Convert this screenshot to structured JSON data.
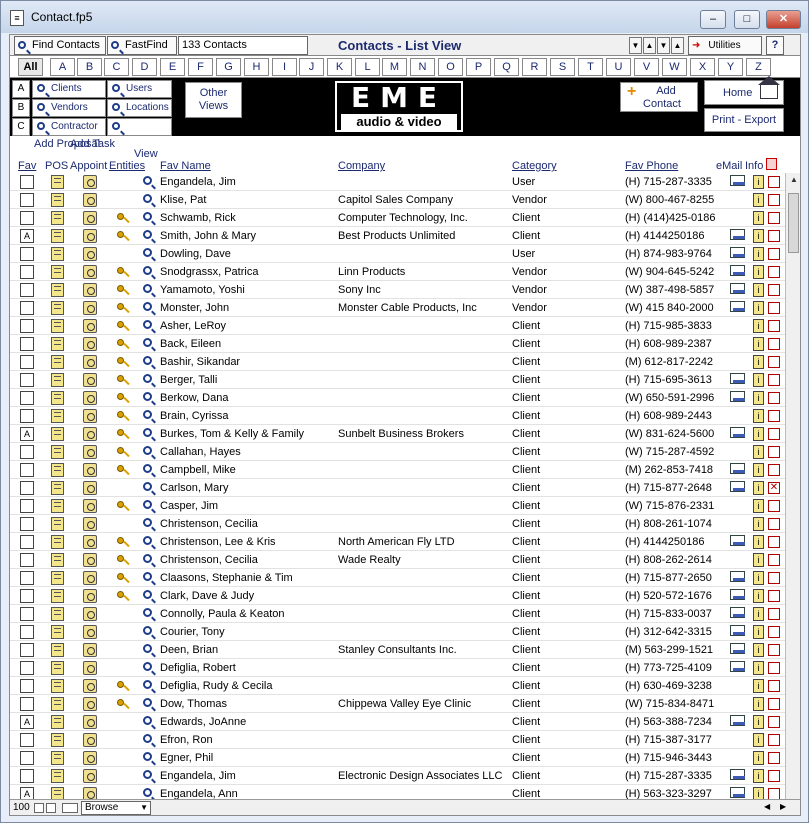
{
  "window": {
    "title": "Contact.fp5"
  },
  "toolbar": {
    "find_label": "Find Contacts",
    "fastfind_label": "FastFind",
    "count_label": "133 Contacts",
    "heading": "Contacts - List View",
    "utilities_label": "Utilities",
    "help_label": "?"
  },
  "alphabet": [
    "All",
    "A",
    "B",
    "C",
    "D",
    "E",
    "F",
    "G",
    "H",
    "I",
    "J",
    "K",
    "L",
    "M",
    "N",
    "O",
    "P",
    "Q",
    "R",
    "S",
    "T",
    "U",
    "V",
    "W",
    "X",
    "Y",
    "Z"
  ],
  "nav": {
    "rows": [
      {
        "letter": "A",
        "left": "Clients",
        "right": "Users"
      },
      {
        "letter": "B",
        "left": "Vendors",
        "right": "Locations"
      },
      {
        "letter": "C",
        "left": "Contractor",
        "right": ""
      }
    ],
    "other_views_line1": "Other",
    "other_views_line2": "Views",
    "logo_top": "EME",
    "logo_bottom": "audio & video",
    "add_contact_line1": "Add",
    "add_contact_line2": "Contact",
    "home_label": "Home",
    "print_export_label": "Print - Export"
  },
  "columns": {
    "add_proposal": "Add Proposal",
    "add_task": "Add Task",
    "view": "View",
    "fav": "Fav",
    "pos": "POS",
    "appoint": "Appoint",
    "entities": "Entities",
    "fav_name": "Fav Name",
    "company": "Company",
    "category": "Category",
    "fav_phone": "Fav Phone",
    "email": "eMail",
    "info": "Info"
  },
  "rows": [
    {
      "fav": "",
      "key": false,
      "name": "Engandela, Jim",
      "company": "",
      "category": "User",
      "phone": "(H) 715-287-3335",
      "email": true,
      "del": false
    },
    {
      "fav": "",
      "key": false,
      "name": "Klise, Pat",
      "company": "Capitol Sales Company",
      "category": "Vendor",
      "phone": "(W) 800-467-8255",
      "email": false,
      "del": false
    },
    {
      "fav": "",
      "key": true,
      "name": "Schwamb, Rick",
      "company": "Computer Technology, Inc.",
      "category": "Client",
      "phone": "(H) (414)425-0186",
      "email": false,
      "del": false
    },
    {
      "fav": "A",
      "key": true,
      "name": "Smith, John & Mary",
      "company": "Best Products Unlimited",
      "category": "Client",
      "phone": "(H) 4144250186",
      "email": true,
      "del": false
    },
    {
      "fav": "",
      "key": false,
      "name": "Dowling, Dave",
      "company": "",
      "category": "User",
      "phone": "(H) 874-983-9764",
      "email": true,
      "del": false
    },
    {
      "fav": "",
      "key": true,
      "name": "Snodgrassx, Patrica",
      "company": "Linn Products",
      "category": "Vendor",
      "phone": "(W) 904-645-5242",
      "email": true,
      "del": false
    },
    {
      "fav": "",
      "key": true,
      "name": "Yamamoto, Yoshi",
      "company": "Sony Inc",
      "category": "Vendor",
      "phone": "(W) 387-498-5857",
      "email": true,
      "del": false
    },
    {
      "fav": "",
      "key": true,
      "name": "Monster, John",
      "company": "Monster Cable Products, Inc",
      "category": "Vendor",
      "phone": "(W) 415 840-2000",
      "email": true,
      "del": false
    },
    {
      "fav": "",
      "key": true,
      "name": "Asher, LeRoy",
      "company": "",
      "category": "Client",
      "phone": "(H) 715-985-3833",
      "email": false,
      "del": false
    },
    {
      "fav": "",
      "key": true,
      "name": "Back, Eileen",
      "company": "",
      "category": "Client",
      "phone": "(H) 608-989-2387",
      "email": false,
      "del": false
    },
    {
      "fav": "",
      "key": true,
      "name": "Bashir, Sikandar",
      "company": "",
      "category": "Client",
      "phone": "(M) 612-817-2242",
      "email": false,
      "del": false
    },
    {
      "fav": "",
      "key": true,
      "name": "Berger, Talli",
      "company": "",
      "category": "Client",
      "phone": "(H) 715-695-3613",
      "email": true,
      "del": false
    },
    {
      "fav": "",
      "key": true,
      "name": "Berkow, Dana",
      "company": "",
      "category": "Client",
      "phone": "(W) 650-591-2996",
      "email": true,
      "del": false
    },
    {
      "fav": "",
      "key": true,
      "name": "Brain, Cyrissa",
      "company": "",
      "category": "Client",
      "phone": "(H) 608-989-2443",
      "email": false,
      "del": false
    },
    {
      "fav": "A",
      "key": true,
      "name": "Burkes, Tom & Kelly & Family",
      "company": "Sunbelt Business Brokers",
      "category": "Client",
      "phone": "(W) 831-624-5600",
      "email": true,
      "del": false
    },
    {
      "fav": "",
      "key": true,
      "name": "Callahan, Hayes",
      "company": "",
      "category": "Client",
      "phone": "(W) 715-287-4592",
      "email": false,
      "del": false
    },
    {
      "fav": "",
      "key": true,
      "name": "Campbell, Mike",
      "company": "",
      "category": "Client",
      "phone": "(M) 262-853-7418",
      "email": true,
      "del": false
    },
    {
      "fav": "",
      "key": false,
      "name": "Carlson, Mary",
      "company": "",
      "category": "Client",
      "phone": "(H) 715-877-2648",
      "email": true,
      "del": true
    },
    {
      "fav": "",
      "key": true,
      "name": "Casper, Jim",
      "company": "",
      "category": "Client",
      "phone": "(W) 715-876-2331",
      "email": false,
      "del": false
    },
    {
      "fav": "",
      "key": false,
      "name": "Christenson, Cecilia",
      "company": "",
      "category": "Client",
      "phone": "(H) 808-261-1074",
      "email": false,
      "del": false
    },
    {
      "fav": "",
      "key": true,
      "name": "Christenson, Lee & Kris",
      "company": "North American Fly LTD",
      "category": "Client",
      "phone": "(H) 4144250186",
      "email": true,
      "del": false
    },
    {
      "fav": "",
      "key": true,
      "name": "Christenson, Cecilia",
      "company": "Wade Realty",
      "category": "Client",
      "phone": "(H) 808-262-2614",
      "email": false,
      "del": false
    },
    {
      "fav": "",
      "key": true,
      "name": "Claasons, Stephanie & Tim",
      "company": "",
      "category": "Client",
      "phone": "(H) 715-877-2650",
      "email": true,
      "del": false
    },
    {
      "fav": "",
      "key": true,
      "name": "Clark, Dave & Judy",
      "company": "",
      "category": "Client",
      "phone": "(H) 520-572-1676",
      "email": true,
      "del": false
    },
    {
      "fav": "",
      "key": false,
      "name": "Connolly, Paula & Keaton",
      "company": "",
      "category": "Client",
      "phone": "(H) 715-833-0037",
      "email": true,
      "del": false
    },
    {
      "fav": "",
      "key": false,
      "name": "Courier, Tony",
      "company": "",
      "category": "Client",
      "phone": "(H) 312-642-3315",
      "email": true,
      "del": false
    },
    {
      "fav": "",
      "key": false,
      "name": "Deen, Brian",
      "company": "Stanley Consultants Inc.",
      "category": "Client",
      "phone": "(M) 563-299-1521",
      "email": true,
      "del": false
    },
    {
      "fav": "",
      "key": false,
      "name": "Defiglia, Robert",
      "company": "",
      "category": "Client",
      "phone": "(H) 773-725-4109",
      "email": true,
      "del": false
    },
    {
      "fav": "",
      "key": true,
      "name": "Defiglia, Rudy & Cecila",
      "company": "",
      "category": "Client",
      "phone": "(H) 630-469-3238",
      "email": false,
      "del": false
    },
    {
      "fav": "",
      "key": true,
      "name": "Dow, Thomas",
      "company": "Chippewa Valley Eye Clinic",
      "category": "Client",
      "phone": "(W) 715-834-8471",
      "email": false,
      "del": false
    },
    {
      "fav": "A",
      "key": false,
      "name": "Edwards, JoAnne",
      "company": "",
      "category": "Client",
      "phone": "(H) 563-388-7234",
      "email": true,
      "del": false
    },
    {
      "fav": "",
      "key": false,
      "name": "Efron, Ron",
      "company": "",
      "category": "Client",
      "phone": "(H) 715-387-3177",
      "email": false,
      "del": false
    },
    {
      "fav": "",
      "key": false,
      "name": "Egner, Phil",
      "company": "",
      "category": "Client",
      "phone": "(H) 715-946-3443",
      "email": false,
      "del": false
    },
    {
      "fav": "",
      "key": false,
      "name": "Engandela, Jim",
      "company": "Electronic Design Associates LLC",
      "category": "Client",
      "phone": "(H) 715-287-3335",
      "email": true,
      "del": false
    },
    {
      "fav": "A",
      "key": false,
      "name": "Engandela, Ann",
      "company": "",
      "category": "Client",
      "phone": "(H) 563-323-3297",
      "email": true,
      "del": false
    }
  ],
  "status": {
    "zoom": "100",
    "mode": "Browse"
  }
}
